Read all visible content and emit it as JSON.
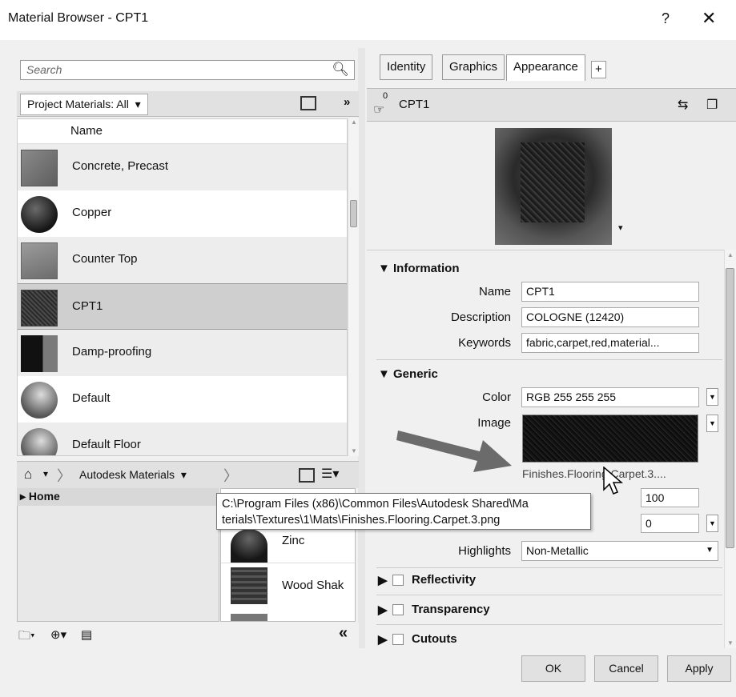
{
  "window": {
    "title": "Material Browser - CPT1",
    "help": "?",
    "close": "✕"
  },
  "left": {
    "search_placeholder": "Search",
    "filter_label": "Project Materials: All",
    "column_name": "Name",
    "materials": [
      {
        "label": "Concrete, Precast",
        "thumb": "concrete"
      },
      {
        "label": "Copper",
        "thumb": "copper"
      },
      {
        "label": "Counter Top",
        "thumb": "counter"
      },
      {
        "label": "CPT1",
        "thumb": "carpet",
        "selected": true
      },
      {
        "label": "Damp-proofing",
        "thumb": "damp"
      },
      {
        "label": "Default",
        "thumb": "default"
      },
      {
        "label": "Default Floor",
        "thumb": "default"
      }
    ],
    "library_label": "Autodesk Materials",
    "tree_home": "Home",
    "grid_items": [
      {
        "label": "Zinc"
      },
      {
        "label": "Wood Shak"
      }
    ],
    "collapse": "«"
  },
  "right": {
    "tabs": [
      "Identity",
      "Graphics",
      "Appearance",
      "+"
    ],
    "asset_count": "0",
    "asset_name": "CPT1",
    "information": {
      "heading": "Information",
      "name_label": "Name",
      "name_value": "CPT1",
      "desc_label": "Description",
      "desc_value": "COLOGNE (12420)",
      "keywords_label": "Keywords",
      "keywords_value": "fabric,carpet,red,material..."
    },
    "generic": {
      "heading": "Generic",
      "color_label": "Color",
      "color_value": "RGB 255 255 255",
      "image_label": "Image",
      "image_name": "Finishes.Flooring.Carpet.3....",
      "fade_value": "100",
      "gloss_value": "0",
      "highlights_label": "Highlights",
      "highlights_value": "Non-Metallic"
    },
    "sections": [
      "Reflectivity",
      "Transparency",
      "Cutouts"
    ]
  },
  "tooltip": {
    "line1": "C:\\Program Files (x86)\\Common Files\\Autodesk Shared\\Ma",
    "line2": "terials\\Textures\\1\\Mats\\Finishes.Flooring.Carpet.3.png"
  },
  "buttons": {
    "ok": "OK",
    "cancel": "Cancel",
    "apply": "Apply"
  }
}
